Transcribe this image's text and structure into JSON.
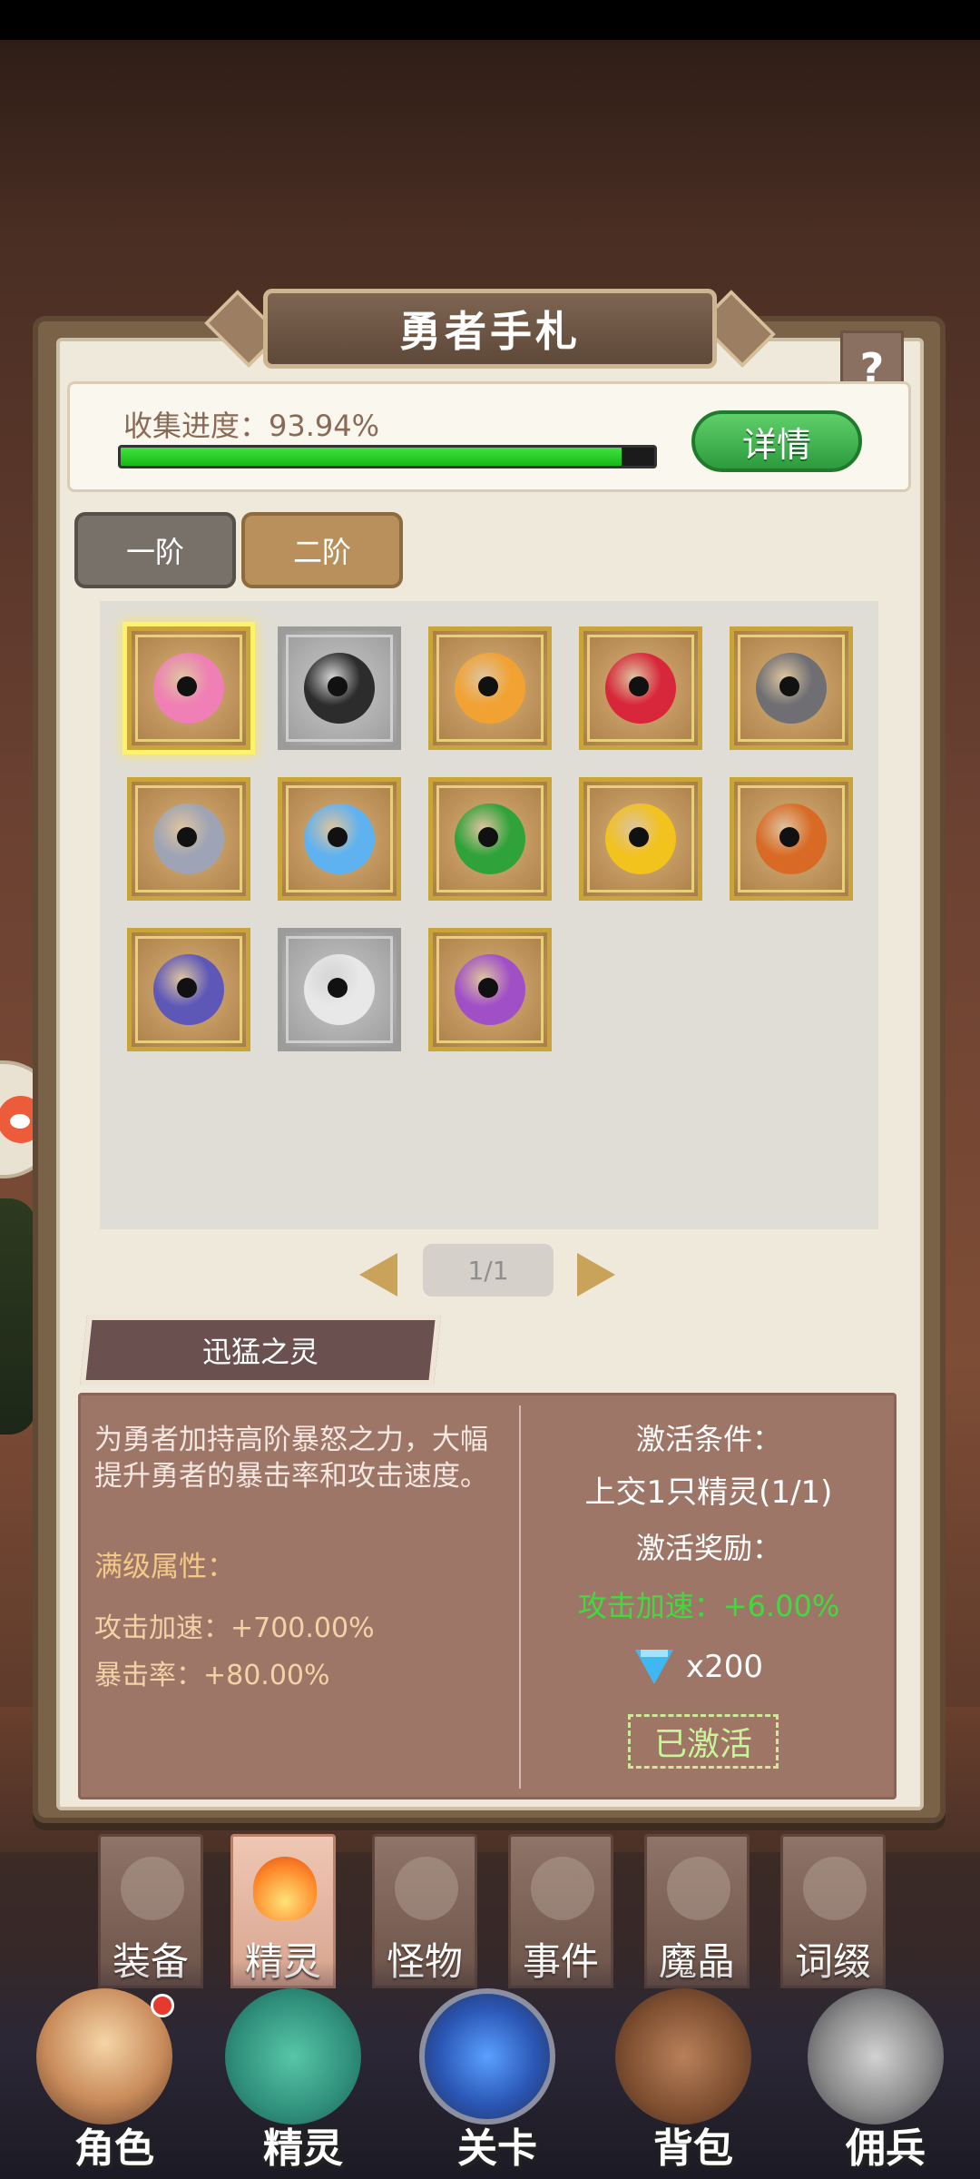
{
  "panel": {
    "title": "勇者手札",
    "help_label": "?"
  },
  "progress": {
    "label": "收集进度：93.94%",
    "fraction": 0.9394,
    "detail_button": "详情"
  },
  "tabs": [
    {
      "label": "一阶",
      "active": false
    },
    {
      "label": "二阶",
      "active": true
    }
  ],
  "spirits": [
    {
      "icon": "pink-bird-spirit-icon",
      "color": "#f07fb5",
      "state": "selected"
    },
    {
      "icon": "black-helmet-spirit-icon",
      "color": "#2c2c2c",
      "state": "locked"
    },
    {
      "icon": "flame-blade-spirit-icon",
      "color": "#f2a233",
      "state": "owned"
    },
    {
      "icon": "red-cat-spirit-icon",
      "color": "#d8263a",
      "state": "owned"
    },
    {
      "icon": "grey-dragon-spirit-icon",
      "color": "#6f6f73",
      "state": "owned"
    },
    {
      "icon": "horned-helmet-spirit-icon",
      "color": "#9ea4b5",
      "state": "owned"
    },
    {
      "icon": "ice-crystal-spirit-icon",
      "color": "#5fb2f0",
      "state": "owned"
    },
    {
      "icon": "green-slime-spirit-icon",
      "color": "#2fa23a",
      "state": "owned"
    },
    {
      "icon": "lightning-spirit-icon",
      "color": "#f2c21d",
      "state": "owned"
    },
    {
      "icon": "lava-spirit-icon",
      "color": "#d86a25",
      "state": "owned"
    },
    {
      "icon": "purple-ghost-spirit-icon",
      "color": "#5d57b8",
      "state": "owned"
    },
    {
      "icon": "white-star-spirit-icon",
      "color": "#e8e8e8",
      "state": "locked"
    },
    {
      "icon": "gem-crown-spirit-icon",
      "color": "#a04fc7",
      "state": "owned"
    }
  ],
  "pagination": {
    "label": "1/1"
  },
  "selected_spirit": {
    "name": "迅猛之灵",
    "description": "为勇者加持高阶暴怒之力，大幅提升勇者的暴击率和攻击速度。",
    "max_label": "满级属性：",
    "stats": [
      "攻击加速：+700.00%",
      "暴击率：+80.00%"
    ],
    "activation_title": "激活条件：",
    "activation_value": "上交1只精灵(1/1)",
    "reward_title": "激活奖励：",
    "reward_value": "攻击加速：+6.00%",
    "gem_amount": "x200",
    "activated_label": "已激活"
  },
  "categories": [
    {
      "label": "装备",
      "icon": "helmet-icon",
      "active": false
    },
    {
      "label": "精灵",
      "icon": "flame-spirit-icon",
      "active": true
    },
    {
      "label": "怪物",
      "icon": "dragon-icon",
      "active": false
    },
    {
      "label": "事件",
      "icon": "scroll-icon",
      "active": false
    },
    {
      "label": "魔晶",
      "icon": "crystal-icon",
      "active": false
    },
    {
      "label": "词缀",
      "icon": "swirl-icon",
      "active": false
    }
  ],
  "bottom_nav": [
    {
      "label": "角色",
      "icon": "hero-portrait-icon"
    },
    {
      "label": "精灵",
      "icon": "spirit-portrait-icon"
    },
    {
      "label": "关卡",
      "icon": "stage-gate-icon"
    },
    {
      "label": "背包",
      "icon": "backpack-icon"
    },
    {
      "label": "佣兵",
      "icon": "knight-helmet-icon"
    }
  ]
}
